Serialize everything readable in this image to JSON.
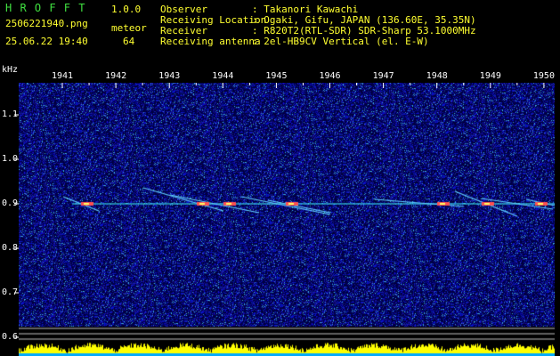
{
  "header": {
    "app_name": "H R O F F T",
    "version": "1.0.0",
    "file_name": "2506221940.png",
    "mode_label": "meteor",
    "datetime": "25.06.22 19:40",
    "count": "64",
    "fields": [
      {
        "label": "Observer",
        "value": ": Takanori Kawachi"
      },
      {
        "label": "Receiving Location",
        "value": ": Ogaki, Gifu, JAPAN (136.60E, 35.35N)"
      },
      {
        "label": "Receiver",
        "value": ": R820T2(RTL-SDR) SDR-Sharp 53.1000MHz"
      },
      {
        "label": "Receiving antenna",
        "value": ": 2el-HB9CV Vertical (el. E-W)"
      }
    ]
  },
  "spectrogram": {
    "y_unit": "kHz",
    "time_ticks": [
      "1941",
      "1942",
      "1943",
      "1944",
      "1945",
      "1946",
      "1947",
      "1948",
      "1949",
      "1950"
    ],
    "freq_ticks": [
      "1.1",
      "1.0",
      "0.9",
      "0.8",
      "0.7",
      "0.6"
    ],
    "freq_values": [
      1.1,
      1.0,
      0.9,
      0.8,
      0.7,
      0.6
    ],
    "freq_range": [
      0.58,
      1.2
    ],
    "carrier_khz": 0.9,
    "colors": {
      "background": "#00003c",
      "noise": "#1a2aa0",
      "carrier": "#40ffff",
      "echo_core": "#ff5050",
      "tick": "#ffffff",
      "band_fill": "#ffff00",
      "band_base": "#00aaff"
    }
  }
}
